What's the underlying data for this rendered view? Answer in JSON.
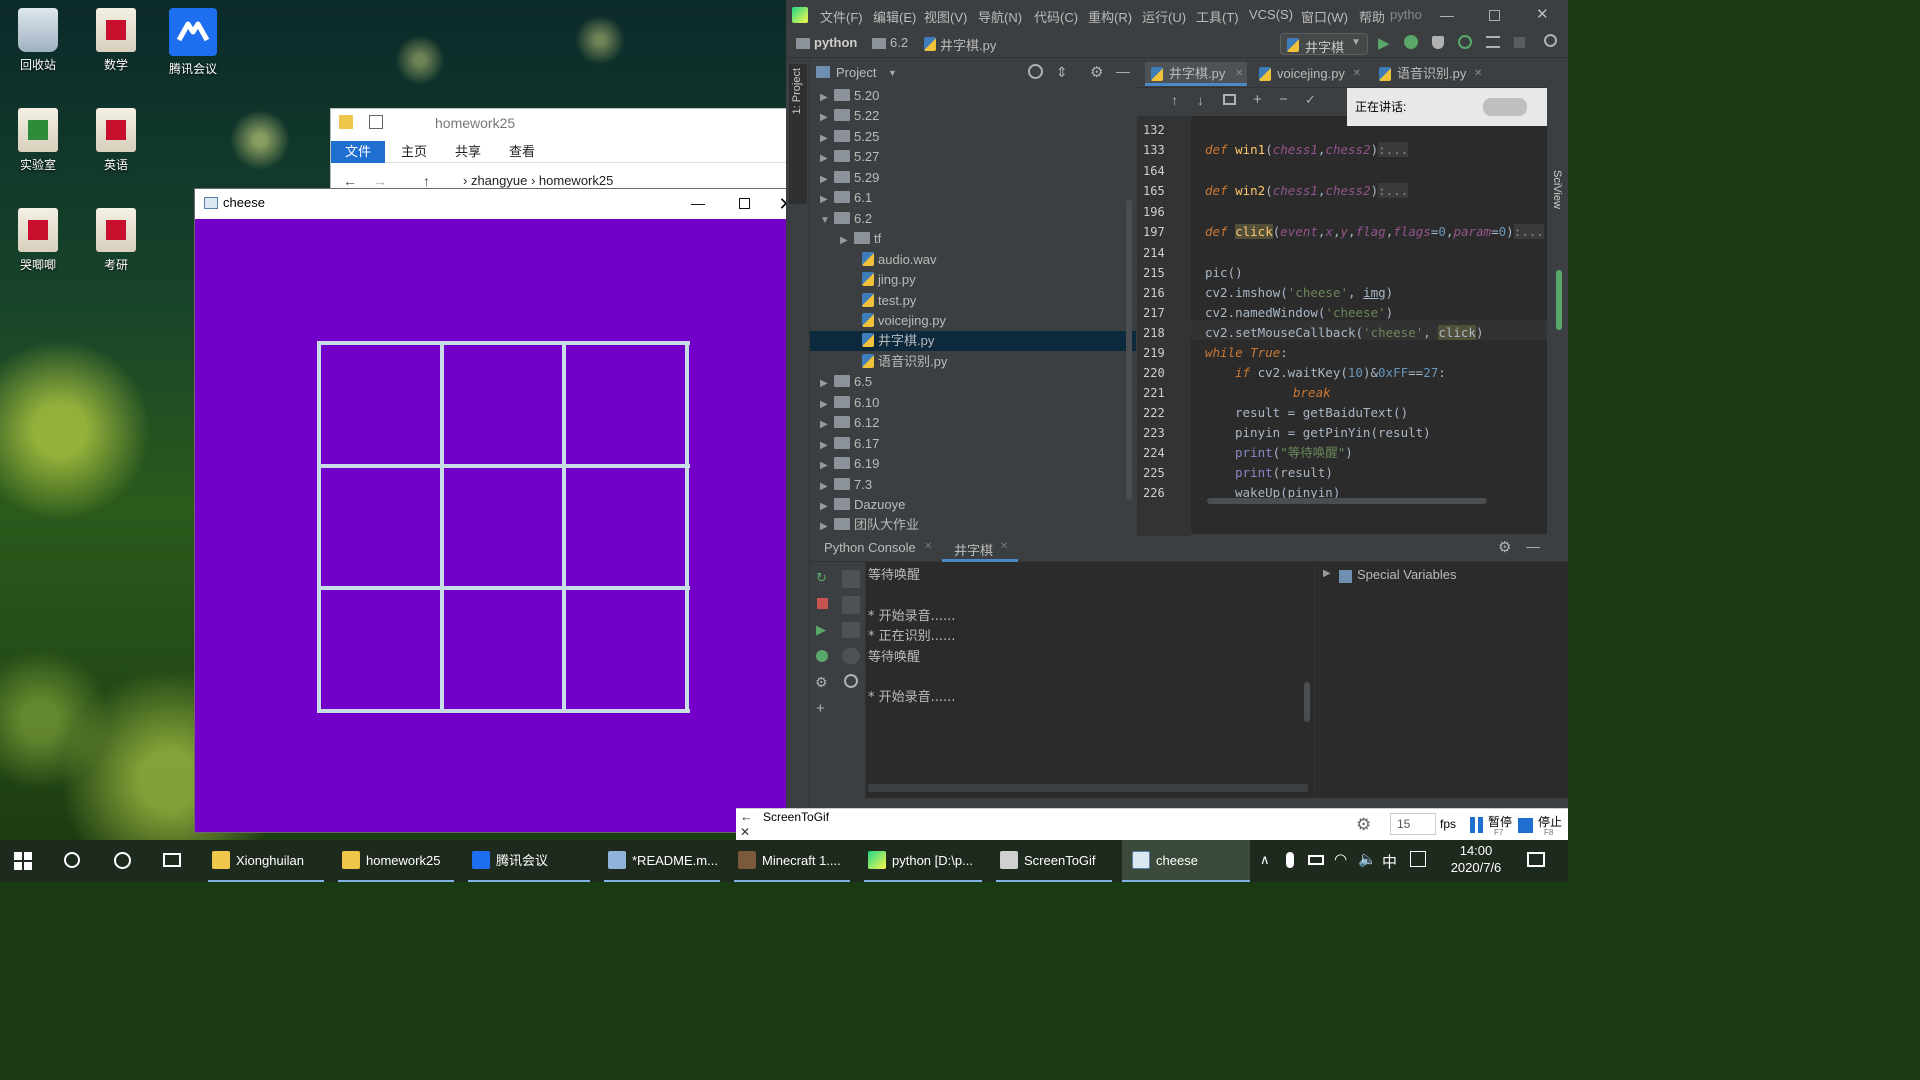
{
  "desktop": {
    "icons": [
      {
        "label": "回收站"
      },
      {
        "label": "数学"
      },
      {
        "label": "腾讯会议"
      },
      {
        "label": "实验室"
      },
      {
        "label": "英语"
      },
      {
        "label": "哭唧唧"
      },
      {
        "label": "考研"
      }
    ]
  },
  "explorer": {
    "title": "homework25",
    "tabs": [
      "文件",
      "主页",
      "共享",
      "查看"
    ],
    "path": [
      "zhangyue",
      "homework25"
    ]
  },
  "cheese_window": {
    "title": "cheese",
    "board_color": "#7200c8",
    "grid_color": "#c9dde6"
  },
  "pycharm": {
    "menu": [
      "文件(F)",
      "编辑(E)",
      "视图(V)",
      "导航(N)",
      "代码(C)",
      "重构(R)",
      "运行(U)",
      "工具(T)",
      "VCS(S)",
      "窗口(W)",
      "帮助",
      "pytho"
    ],
    "breadcrumb": [
      "python",
      "6.2",
      "井字棋.py"
    ],
    "run_config": "井字棋",
    "side_label": "1: Project",
    "right_label": "SciView",
    "project_header": "Project",
    "tree": [
      {
        "name": "5.20",
        "type": "folder",
        "depth": 0
      },
      {
        "name": "5.22",
        "type": "folder",
        "depth": 0
      },
      {
        "name": "5.25",
        "type": "folder",
        "depth": 0
      },
      {
        "name": "5.27",
        "type": "folder",
        "depth": 0
      },
      {
        "name": "5.29",
        "type": "folder",
        "depth": 0
      },
      {
        "name": "6.1",
        "type": "folder",
        "depth": 0
      },
      {
        "name": "6.2",
        "type": "folder-open",
        "depth": 0
      },
      {
        "name": "tf",
        "type": "folder",
        "depth": 1
      },
      {
        "name": "audio.wav",
        "type": "file",
        "depth": 1
      },
      {
        "name": "jing.py",
        "type": "py",
        "depth": 1
      },
      {
        "name": "test.py",
        "type": "py",
        "depth": 1
      },
      {
        "name": "voicejing.py",
        "type": "py",
        "depth": 1
      },
      {
        "name": "井字棋.py",
        "type": "py",
        "depth": 1,
        "selected": true
      },
      {
        "name": "语音识别.py",
        "type": "py",
        "depth": 1
      },
      {
        "name": "6.5",
        "type": "folder",
        "depth": 0
      },
      {
        "name": "6.10",
        "type": "folder",
        "depth": 0
      },
      {
        "name": "6.12",
        "type": "folder",
        "depth": 0
      },
      {
        "name": "6.17",
        "type": "folder",
        "depth": 0
      },
      {
        "name": "6.19",
        "type": "folder",
        "depth": 0
      },
      {
        "name": "7.3",
        "type": "folder",
        "depth": 0
      },
      {
        "name": "Dazuoye",
        "type": "folder",
        "depth": 0
      },
      {
        "name": "团队大作业",
        "type": "folder",
        "depth": 0
      }
    ],
    "editor_tabs": [
      "井字棋.py",
      "voicejing.py",
      "语音识别.py"
    ],
    "speaking_label": "正在讲话:",
    "line_numbers": [
      "132",
      "133",
      "164",
      "165",
      "196",
      "197",
      "214",
      "215",
      "216",
      "217",
      "218",
      "219",
      "220",
      "221",
      "222",
      "223",
      "224",
      "225",
      "226"
    ],
    "console_tabs": [
      "Python Console",
      "井字棋"
    ],
    "console_lines": [
      "等待唤醒",
      "",
      "* 开始录音......",
      "* 正在识别......",
      "等待唤醒",
      "",
      "* 开始录音......"
    ],
    "special_variables": "Special Variables"
  },
  "screentogif": {
    "title": "ScreenToGif",
    "fps_value": "15",
    "fps_label": "fps",
    "pause_label": "暂停",
    "pause_key": "F7",
    "stop_label": "停止",
    "stop_key": "F8"
  },
  "taskbar": {
    "items": [
      "Xionghuilan",
      "homework25",
      "腾讯会议",
      "*README.m...",
      "Minecraft 1....",
      "python [D:\\p...",
      "ScreenToGif",
      "cheese"
    ],
    "ime": "中",
    "time": "14:00",
    "date": "2020/7/6"
  }
}
